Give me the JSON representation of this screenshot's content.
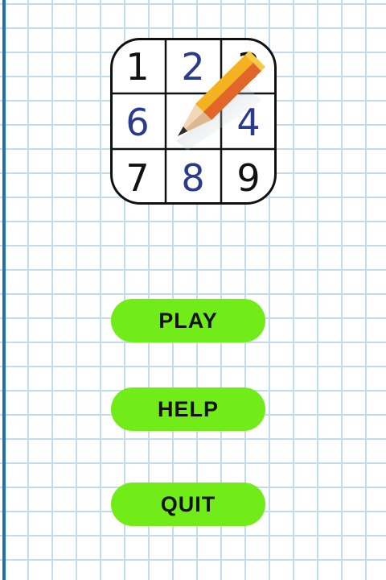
{
  "logo": {
    "icon": "sudoku-grid-pencil-icon",
    "cells": [
      "1",
      "2",
      "3",
      "6",
      "",
      "4",
      "7",
      "8",
      "9"
    ],
    "colors": {
      "black_digit": "#111111",
      "blue_digit": "#2a3a8c",
      "pencil_body": "#f3b321",
      "pencil_shade": "#e2662a"
    }
  },
  "menu": {
    "play_label": "PLAY",
    "help_label": "HELP",
    "quit_label": "QUIT",
    "button_color": "#72ec18"
  }
}
